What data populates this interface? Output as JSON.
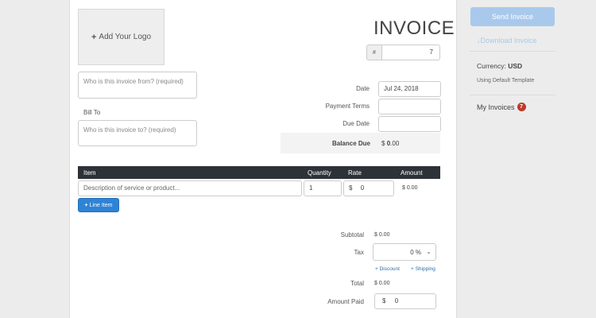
{
  "logo": {
    "plus": "+",
    "label": "Add Your Logo"
  },
  "invoice": {
    "title": "INVOICE",
    "number_prefix": "#",
    "number": "7"
  },
  "parties": {
    "from_placeholder": "Who is this invoice from? (required)",
    "bill_to_label": "Bill To",
    "to_placeholder": "Who is this invoice to? (required)"
  },
  "meta": {
    "date_label": "Date",
    "date_value": "Jul 24, 2018",
    "payment_terms_label": "Payment Terms",
    "payment_terms_value": "",
    "due_date_label": "Due Date",
    "due_date_value": "",
    "balance_due_label": "Balance Due",
    "balance_due_currency": "$",
    "balance_due_int": "0",
    "balance_due_dec": ".00"
  },
  "table": {
    "headers": {
      "item": "Item",
      "quantity": "Quantity",
      "rate": "Rate",
      "amount": "Amount"
    },
    "row": {
      "description_placeholder": "Description of service or product...",
      "quantity": "1",
      "rate_currency": "$",
      "rate": "0",
      "amount": "$ 0.00"
    },
    "add_line_plus": "+",
    "add_line_label": "Line Item"
  },
  "totals": {
    "subtotal_label": "Subtotal",
    "subtotal_value": "$ 0.00",
    "tax_label": "Tax",
    "tax_value": "0 %",
    "discount_link": "+ Discount",
    "shipping_link": "+ Shipping",
    "total_label": "Total",
    "total_value": "$ 0.00",
    "amount_paid_label": "Amount Paid",
    "amount_paid_currency": "$",
    "amount_paid_value": "0"
  },
  "sidebar": {
    "send_label": "Send Invoice",
    "download_label": "Download Invoice",
    "currency_prefix": "Currency:",
    "currency_value": "USD",
    "template_text": "Using Default Template",
    "my_invoices_label": "My Invoices",
    "my_invoices_count": "7"
  },
  "colors": {
    "accent": "#2f83d6",
    "send_disabled": "#a9c9ec",
    "table_header": "#2d3238",
    "badge": "#c0392b"
  }
}
